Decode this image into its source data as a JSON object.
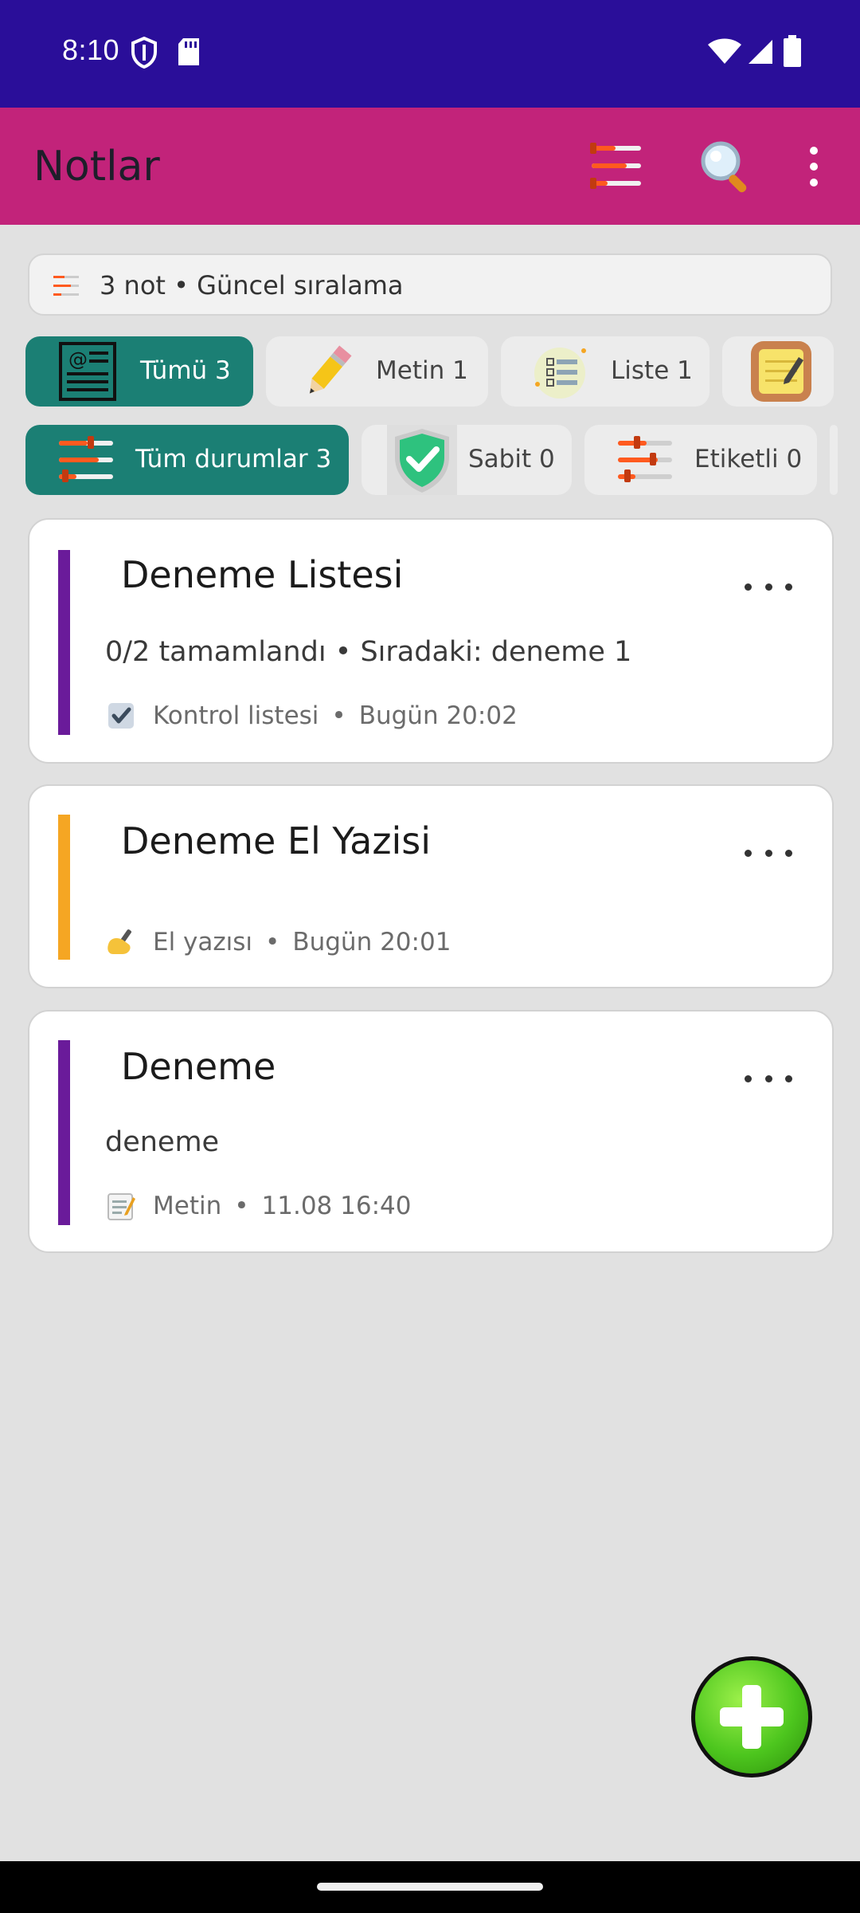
{
  "status_bar": {
    "time": "8:10"
  },
  "app_bar": {
    "title": "Notlar"
  },
  "summary": {
    "text": "3 not • Güncel sıralama"
  },
  "type_filters": [
    {
      "label": "Tümü 3",
      "icon": "newspaper-icon",
      "selected": true
    },
    {
      "label": "Metin 1",
      "icon": "pencil-icon",
      "selected": false
    },
    {
      "label": "Liste 1",
      "icon": "checklist-icon",
      "selected": false
    },
    {
      "label": "",
      "icon": "notepad-icon",
      "selected": false
    }
  ],
  "status_filters": [
    {
      "label": "Tüm durumlar 3",
      "icon": "sliders-icon",
      "selected": true
    },
    {
      "label": "Sabit 0",
      "icon": "shield-check-icon",
      "selected": false
    },
    {
      "label": "Etiketli 0",
      "icon": "sliders-icon",
      "selected": false
    }
  ],
  "notes": [
    {
      "title": "Deneme Listesi",
      "body": "0/2 tamamlandı • Sıradaki: deneme 1",
      "type_label": "Kontrol listesi",
      "date": "Bugün 20:02",
      "type_icon": "checkbox-icon",
      "accent": "#6a1b9a"
    },
    {
      "title": "Deneme El Yazisi",
      "body": "",
      "type_label": "El yazısı",
      "date": "Bugün 20:01",
      "type_icon": "writing-hand-icon",
      "accent": "#f5a623"
    },
    {
      "title": "Deneme",
      "body": "deneme",
      "type_label": "Metin",
      "date": "11.08 16:40",
      "type_icon": "memo-icon",
      "accent": "#6a1b9a"
    }
  ],
  "meta_separator": "•",
  "colors": {
    "status_bar": "#2a0e99",
    "app_bar": "#c2237a",
    "chip_selected": "#1b7f74",
    "background": "#e1e1e1"
  }
}
